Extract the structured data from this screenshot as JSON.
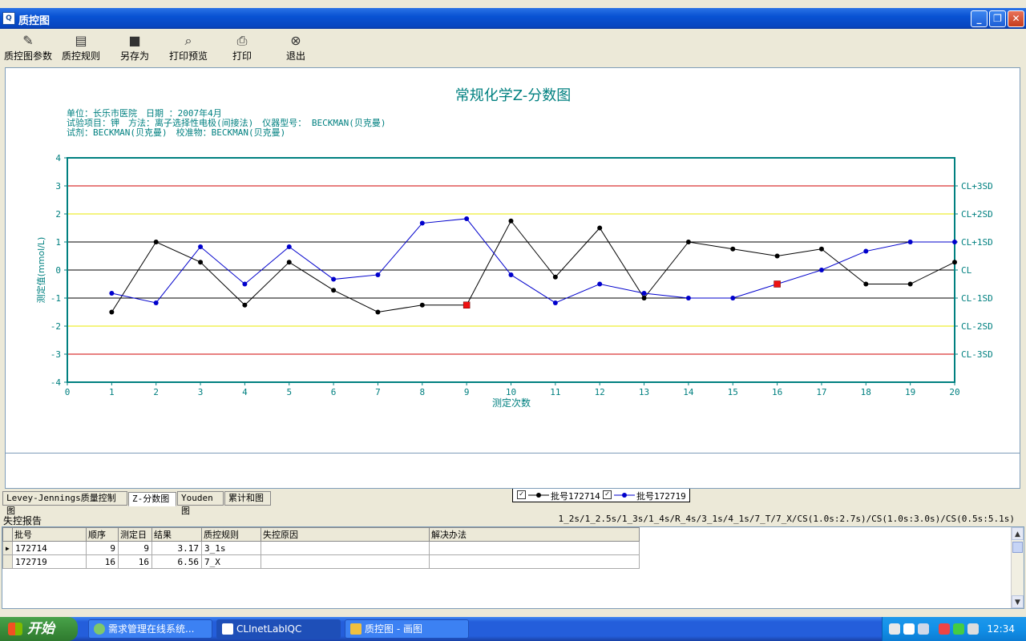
{
  "window": {
    "title": "质控图"
  },
  "toolbar": {
    "params_label": "质控图参数",
    "rules_label": "质控规则",
    "saveas_label": "另存为",
    "preview_label": "打印预览",
    "print_label": "打印",
    "exit_label": "退出"
  },
  "chart_header": {
    "unit_line": "单位：长乐市医院　日期 ：2007年4月",
    "item_line": "试验项目：钾　方法：离子选择性电极(间接法)　仪器型号： BECKMAN(贝克曼)",
    "reagent_line": "试剂：BECKMAN(贝克曼)　校准物：BECKMAN(贝克曼)"
  },
  "chart_data": {
    "type": "line",
    "title": "常规化学Z-分数图",
    "xlabel": "测定次数",
    "ylabel": "测定值(mmol/L)",
    "xlim": [
      0,
      20
    ],
    "ylim": [
      -4,
      4
    ],
    "x_ticks": [
      "0",
      "1",
      "2",
      "3",
      "4",
      "5",
      "6",
      "7",
      "8",
      "9",
      "10",
      "11",
      "12",
      "13",
      "14",
      "15",
      "16",
      "17",
      "18",
      "19",
      "20"
    ],
    "y_ticks": [
      "4",
      "3",
      "2",
      "1",
      "0",
      "-1",
      "-2",
      "-3",
      "-4"
    ],
    "right_labels": [
      {
        "y": 3,
        "text": "CL+3SD"
      },
      {
        "y": 2,
        "text": "CL+2SD"
      },
      {
        "y": 1,
        "text": "CL+1SD"
      },
      {
        "y": 0,
        "text": "CL"
      },
      {
        "y": -1,
        "text": "CL-1SD"
      },
      {
        "y": -2,
        "text": "CL-2SD"
      },
      {
        "y": -3,
        "text": "CL-3SD"
      }
    ],
    "reference_lines": [
      {
        "y": 3,
        "color": "#d00000"
      },
      {
        "y": 2,
        "color": "#e8e800"
      },
      {
        "y": 1,
        "color": "#000000"
      },
      {
        "y": 0,
        "color": "#000000"
      },
      {
        "y": -1,
        "color": "#000000"
      },
      {
        "y": -2,
        "color": "#e8e800"
      },
      {
        "y": -3,
        "color": "#d00000"
      }
    ],
    "series": [
      {
        "name": "批号172714",
        "color": "#000000",
        "x": [
          1,
          2,
          3,
          4,
          5,
          6,
          7,
          8,
          9,
          10,
          11,
          12,
          13,
          14,
          15,
          16,
          17,
          18,
          19,
          20
        ],
        "values": [
          -1.5,
          1.0,
          0.28,
          -1.25,
          0.28,
          -0.72,
          -1.5,
          -1.25,
          -1.25,
          1.75,
          -0.25,
          1.5,
          -1.0,
          1.0,
          0.75,
          0.5,
          0.75,
          -0.5,
          -0.5,
          0.28
        ],
        "flagged": [
          9
        ]
      },
      {
        "name": "批号172719",
        "color": "#0000cc",
        "x": [
          1,
          2,
          3,
          4,
          5,
          6,
          7,
          8,
          9,
          10,
          11,
          12,
          13,
          14,
          15,
          16,
          17,
          18,
          19,
          20
        ],
        "values": [
          -0.83,
          -1.17,
          0.83,
          -0.5,
          0.83,
          -0.33,
          -0.17,
          1.67,
          1.83,
          -0.17,
          -1.17,
          -0.5,
          -0.83,
          -1.0,
          -1.0,
          -0.5,
          0.0,
          0.67,
          1.0,
          1.0
        ],
        "flagged": [
          16
        ]
      }
    ],
    "flag_color": "#ee1111",
    "axis_color": "#008080",
    "text_color": "#008080"
  },
  "tabs": [
    {
      "label": "Levey-Jennings质量控制图"
    },
    {
      "label": "Z-分数图"
    },
    {
      "label": "Youden图"
    },
    {
      "label": "累计和图"
    }
  ],
  "report": {
    "title": "失控报告",
    "rules": "1_2s/1_2.5s/1_3s/1_4s/R_4s/3_1s/4_1s/7_T/7_X/CS(1.0s:2.7s)/CS(1.0s:3.0s)/CS(0.5s:5.1s)",
    "columns": [
      "批号",
      "顺序",
      "测定日",
      "结果",
      "质控规则",
      "失控原因",
      "解决办法"
    ],
    "rows": [
      {
        "lot": "172714",
        "seq": "9",
        "day": "9",
        "result": "3.17",
        "rule": "3_1s",
        "reason": "",
        "solution": ""
      },
      {
        "lot": "172719",
        "seq": "16",
        "day": "16",
        "result": "6.56",
        "rule": "7_X",
        "reason": "",
        "solution": ""
      }
    ]
  },
  "taskbar": {
    "start_label": "开始",
    "tasks": [
      {
        "label": "需求管理在线系统..."
      },
      {
        "label": "CLInetLabIQC"
      },
      {
        "label": "质控图 - 画图"
      }
    ],
    "clock": "12:34"
  }
}
